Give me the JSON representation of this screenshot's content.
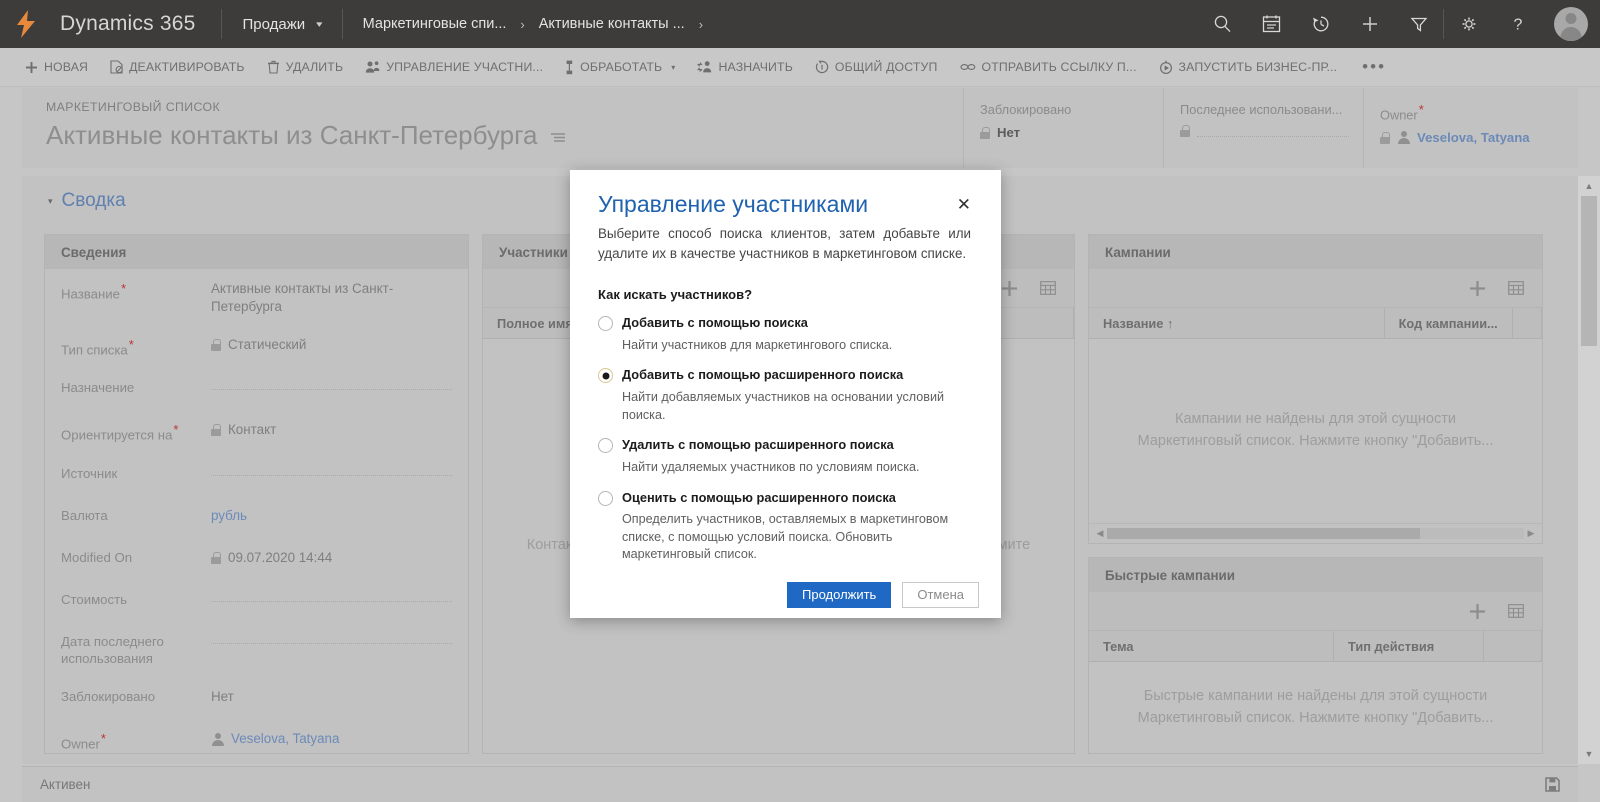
{
  "navbar": {
    "logo_icon": "dynamics-bolt-logo-icon",
    "brand": "Dynamics 365",
    "app": "Продажи",
    "app_chevron_icon": "chevron-down-icon",
    "breadcrumbs": [
      {
        "label": "Маркетинговые спи...",
        "sep": "›"
      },
      {
        "label": "Активные контакты ...",
        "sep": "›"
      }
    ],
    "icons": [
      "search-icon",
      "calendar-icon",
      "recent-history-icon",
      "quick-create-plus-icon",
      "advanced-find-filter-icon",
      "gear-icon",
      "help-question-icon"
    ],
    "avatar": "user-avatar"
  },
  "commandbar": {
    "buttons": [
      {
        "label": "НОВАЯ",
        "icon": "plus-icon",
        "caret": false
      },
      {
        "label": "ДЕАКТИВИРОВАТЬ",
        "icon": "deactivate-icon",
        "caret": false
      },
      {
        "label": "УДАЛИТЬ",
        "icon": "trash-icon",
        "caret": false
      },
      {
        "label": "УПРАВЛЕНИЕ УЧАСТНИ...",
        "icon": "manage-members-icon",
        "caret": false
      },
      {
        "label": "ОБРАБОТАТЬ",
        "icon": "process-icon",
        "caret": true
      },
      {
        "label": "НАЗНАЧИТЬ",
        "icon": "assign-icon",
        "caret": false
      },
      {
        "label": "ОБЩИЙ ДОСТУП",
        "icon": "share-icon",
        "caret": false
      },
      {
        "label": "ОТПРАВИТЬ ССЫЛКУ П...",
        "icon": "email-link-icon",
        "caret": false
      },
      {
        "label": "ЗАПУСТИТЬ БИЗНЕС-ПР...",
        "icon": "run-workflow-icon",
        "caret": false
      }
    ],
    "overflow": "•••"
  },
  "record_header": {
    "eyebrow": "МАРКЕТИНГОВЫЙ СПИСОК",
    "title": "Активные контакты из Санкт-Петербурга",
    "title_menu_icon": "form-selector-icon",
    "fields": [
      {
        "label": "Заблокировано",
        "required": false,
        "value": "Нет",
        "locked": true,
        "empty": false
      },
      {
        "label": "Последнее использовани...",
        "required": false,
        "value": "",
        "locked": true,
        "empty": true
      },
      {
        "label": "Owner",
        "required": true,
        "value": "Veselova, Tatyana",
        "locked": true,
        "empty": false,
        "link": true,
        "person": true
      }
    ]
  },
  "form": {
    "tab_title": "Сводка",
    "tab_collapse_icon": "triangle-collapse-icon",
    "details_panel": {
      "header": "Сведения",
      "fields": [
        {
          "label": "Название",
          "required": true,
          "value": "Активные контакты из Санкт-Петербурга",
          "locked": false,
          "empty": false
        },
        {
          "label": "Тип списка",
          "required": true,
          "value": "Статический",
          "locked": true,
          "empty": false
        },
        {
          "label": "Назначение",
          "required": false,
          "value": "",
          "locked": false,
          "empty": true
        },
        {
          "label": "Ориентируется на",
          "required": true,
          "value": "Контакт",
          "locked": true,
          "empty": false
        },
        {
          "label": "Источник",
          "required": false,
          "value": "",
          "locked": false,
          "empty": true
        },
        {
          "label": "Валюта",
          "required": false,
          "value": "рубль",
          "locked": false,
          "empty": false,
          "link": true
        },
        {
          "label": "Modified On",
          "required": false,
          "value": "09.07.2020  14:44",
          "locked": true,
          "empty": false
        },
        {
          "label": "Стоимость",
          "required": false,
          "value": "",
          "locked": false,
          "empty": true
        },
        {
          "label": "Дата последнего использования",
          "required": false,
          "value": "",
          "locked": false,
          "empty": true
        },
        {
          "label": "Заблокировано",
          "required": false,
          "value": "Нет",
          "locked": false,
          "empty": false
        },
        {
          "label": "Owner",
          "required": true,
          "value": "Veselova, Tatyana",
          "locked": false,
          "empty": false,
          "link": true,
          "person": true
        }
      ]
    },
    "members_panel": {
      "header": "Участники",
      "add_icon": "plus-icon",
      "grid_icon": "open-grid-icon",
      "columns": [
        "Полное имя ↑"
      ],
      "empty_text": "Контакты не найдены для этой сущности Маркетинговый список. Нажмите"
    },
    "campaigns_panel": {
      "header": "Кампании",
      "add_icon": "plus-icon",
      "grid_icon": "open-grid-icon",
      "columns": [
        "Название ↑",
        "Код кампании...",
        ""
      ],
      "empty_text": "Кампании не найдены для этой сущности Маркетинговый список. Нажмите кнопку \"Добавить..."
    },
    "quick_campaigns_panel": {
      "header": "Быстрые кампании",
      "add_icon": "plus-icon",
      "grid_icon": "open-grid-icon",
      "columns": [
        "Тема",
        "Тип действия",
        ""
      ],
      "empty_text": "Быстрые кампании не найдены для этой сущности Маркетинговый список. Нажмите кнопку \"Добавить..."
    }
  },
  "statusbar": {
    "status": "Активен",
    "save_icon": "save-icon"
  },
  "modal": {
    "title": "Управление участниками",
    "close_icon": "close-icon",
    "description": "Выберите способ поиска клиентов, затем добавьте или удалите их в качестве участников в маркетинговом списке.",
    "question": "Как искать участников?",
    "options": [
      {
        "label": "Добавить с помощью поиска",
        "help": "Найти участников для маркетингового списка.",
        "selected": false
      },
      {
        "label": "Добавить с помощью расширенного поиска",
        "help": "Найти добавляемых участников на основании условий поиска.",
        "selected": true
      },
      {
        "label": "Удалить с помощью расширенного поиска",
        "help": "Найти удаляемых участников по условиям поиска.",
        "selected": false
      },
      {
        "label": "Оценить с помощью расширенного поиска",
        "help": "Определить участников, оставляемых в маркетинговом списке, с помощью условий поиска. Обновить маркетинговый список.",
        "selected": false
      }
    ],
    "primary_button": "Продолжить",
    "secondary_button": "Отмена"
  },
  "colors": {
    "nav_bg": "#3b3a39",
    "accent_blue": "#1f68c4",
    "title_blue": "#1f62b0",
    "link_blue": "#6b89b8",
    "required_red": "#b33333",
    "radio_selected_ring": "#d8c890"
  }
}
